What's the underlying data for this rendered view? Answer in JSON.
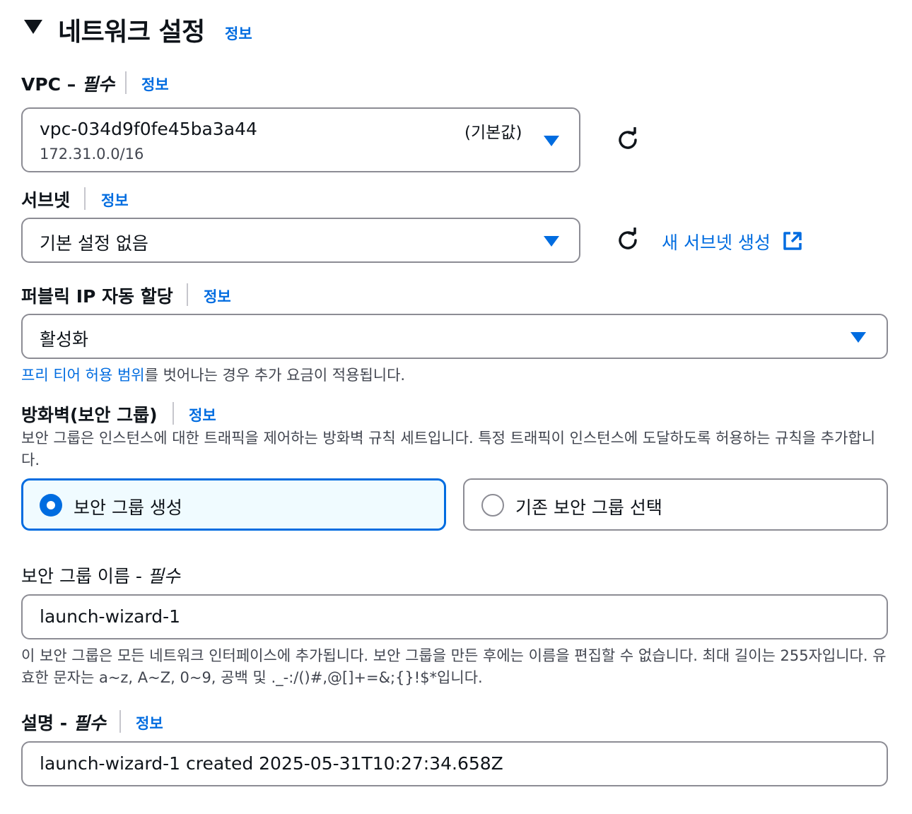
{
  "section": {
    "title": "네트워크 설정",
    "info": "정보"
  },
  "vpc": {
    "label": "VPC – ",
    "required": "필수",
    "info": "정보",
    "value": "vpc-034d9f0fe45ba3a44",
    "cidr": "172.31.0.0/16",
    "tag": "(기본값)",
    "icons": {
      "dropdown": "caret-down-icon",
      "refresh": "refresh-icon"
    }
  },
  "subnet": {
    "label": "서브넷",
    "info": "정보",
    "value": "기본 설정 없음",
    "create_link": "새 서브넷 생성",
    "icons": {
      "refresh": "refresh-icon",
      "external": "external-link-icon"
    }
  },
  "public_ip": {
    "label": "퍼블릭 IP 자동 할당",
    "info": "정보",
    "value": "활성화",
    "hint_link": "프리 티어 허용 범위",
    "hint_rest": "를 벗어나는 경우 추가 요금이 적용됩니다."
  },
  "firewall": {
    "label": "방화벽(보안 그룹)",
    "info": "정보",
    "description": "보안 그룹은 인스턴스에 대한 트래픽을 제어하는 방화벽 규칙 세트입니다. 특정 트래픽이 인스턴스에 도달하도록 허용하는 규칙을 추가합니다.",
    "options": [
      {
        "label": "보안 그룹 생성",
        "selected": true
      },
      {
        "label": "기존 보안 그룹 선택",
        "selected": false
      }
    ]
  },
  "sg_name": {
    "label": "보안 그룹 이름 - ",
    "required": "필수",
    "value": "launch-wizard-1",
    "hint": "이 보안 그룹은 모든 네트워크 인터페이스에 추가됩니다. 보안 그룹을 만든 후에는 이름을 편집할 수 없습니다. 최대 길이는 255자입니다. 유효한 문자는 a~z, A~Z, 0~9, 공백 및 ._-:/()#,@[]+=&;{}!$*입니다."
  },
  "description": {
    "label": "설명 - ",
    "required": "필수",
    "info": "정보",
    "value": "launch-wizard-1 created 2025-05-31T10:27:34.658Z"
  },
  "colors": {
    "link": "#006ce0",
    "text": "#0f141a",
    "border": "#8c8c94",
    "selected_bg": "#f0fbff"
  }
}
